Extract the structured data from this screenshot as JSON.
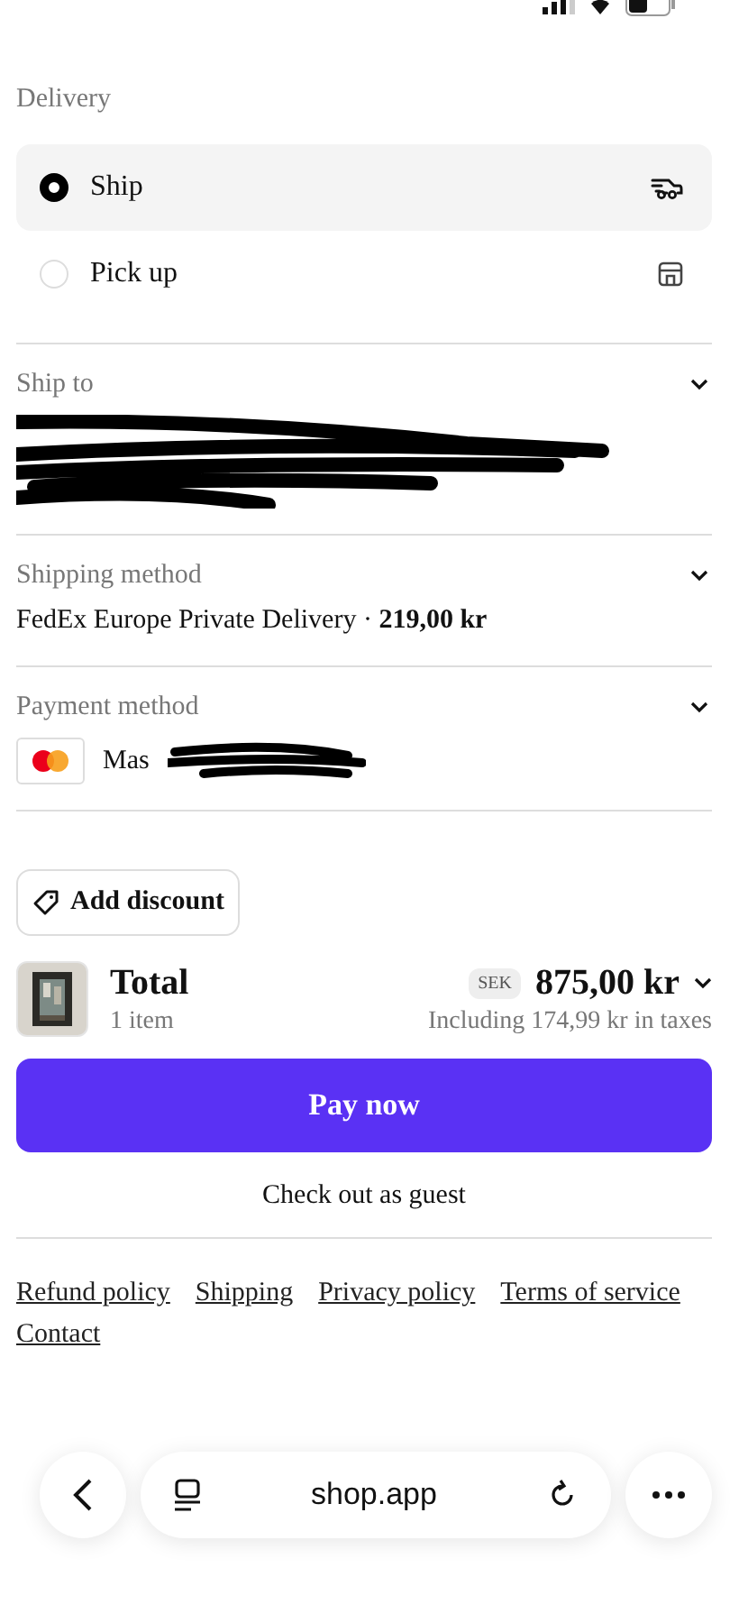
{
  "delivery": {
    "title": "Delivery",
    "options": [
      {
        "label": "Ship",
        "kind": "ship",
        "selected": true
      },
      {
        "label": "Pick up",
        "kind": "pickup",
        "selected": false
      }
    ]
  },
  "sections": [
    {
      "kind": "address",
      "title": "Ship to",
      "redacted": true
    },
    {
      "kind": "shipping",
      "title": "Shipping method",
      "value": "FedEx Europe Private Delivery · **219,00 kr**"
    },
    {
      "kind": "payment",
      "title": "Payment method",
      "value": "Mas",
      "redacted": true
    }
  ],
  "discount": {
    "label": "Add discount"
  },
  "total": {
    "title": "Total",
    "count": "1 item",
    "currency": "SEK",
    "amount": "875,00 kr",
    "taxes": "Including 174,99 kr in taxes"
  },
  "pay_button": "Pay now",
  "guest_link": "Check out as guest",
  "footer_links": [
    "Refund policy",
    "Shipping",
    "Privacy policy",
    "Terms of service",
    "Contact"
  ],
  "browser": {
    "url": "shop.app"
  }
}
